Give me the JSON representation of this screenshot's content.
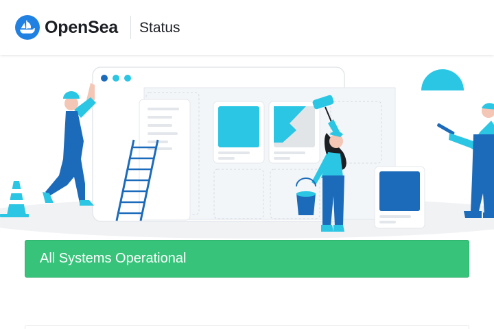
{
  "header": {
    "brand": "OpenSea",
    "page_label": "Status",
    "logo_icon": "opensea-sailboat-icon",
    "brand_color": "#2081e2"
  },
  "hero": {
    "illustration": "maintenance-illustration"
  },
  "status_banner": {
    "text": "All Systems Operational",
    "color": "#37c47a"
  }
}
